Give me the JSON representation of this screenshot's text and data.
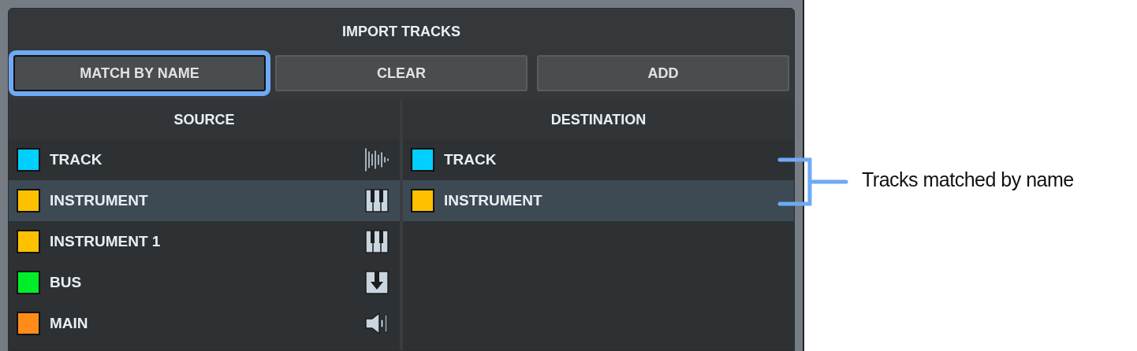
{
  "dialog": {
    "title": "IMPORT TRACKS"
  },
  "buttons": [
    {
      "label": "MATCH BY NAME",
      "highlighted": true
    },
    {
      "label": "CLEAR",
      "highlighted": false
    },
    {
      "label": "ADD",
      "highlighted": false
    }
  ],
  "source": {
    "header": "SOURCE",
    "rows": [
      {
        "name": "TRACK",
        "color": "#00cfff",
        "kind": "audio",
        "selected": false
      },
      {
        "name": "INSTRUMENT",
        "color": "#ffc000",
        "kind": "instrument",
        "selected": true
      },
      {
        "name": "INSTRUMENT 1",
        "color": "#ffc000",
        "kind": "instrument",
        "selected": false
      },
      {
        "name": "BUS",
        "color": "#00ee2a",
        "kind": "bus",
        "selected": false
      },
      {
        "name": "MAIN",
        "color": "#ff8c1a",
        "kind": "main",
        "selected": false
      }
    ]
  },
  "destination": {
    "header": "DESTINATION",
    "rows": [
      {
        "name": "TRACK",
        "color": "#00cfff",
        "selected": false
      },
      {
        "name": "INSTRUMENT",
        "color": "#ffc000",
        "selected": true
      }
    ]
  },
  "callout": {
    "text": "Tracks matched by name"
  }
}
